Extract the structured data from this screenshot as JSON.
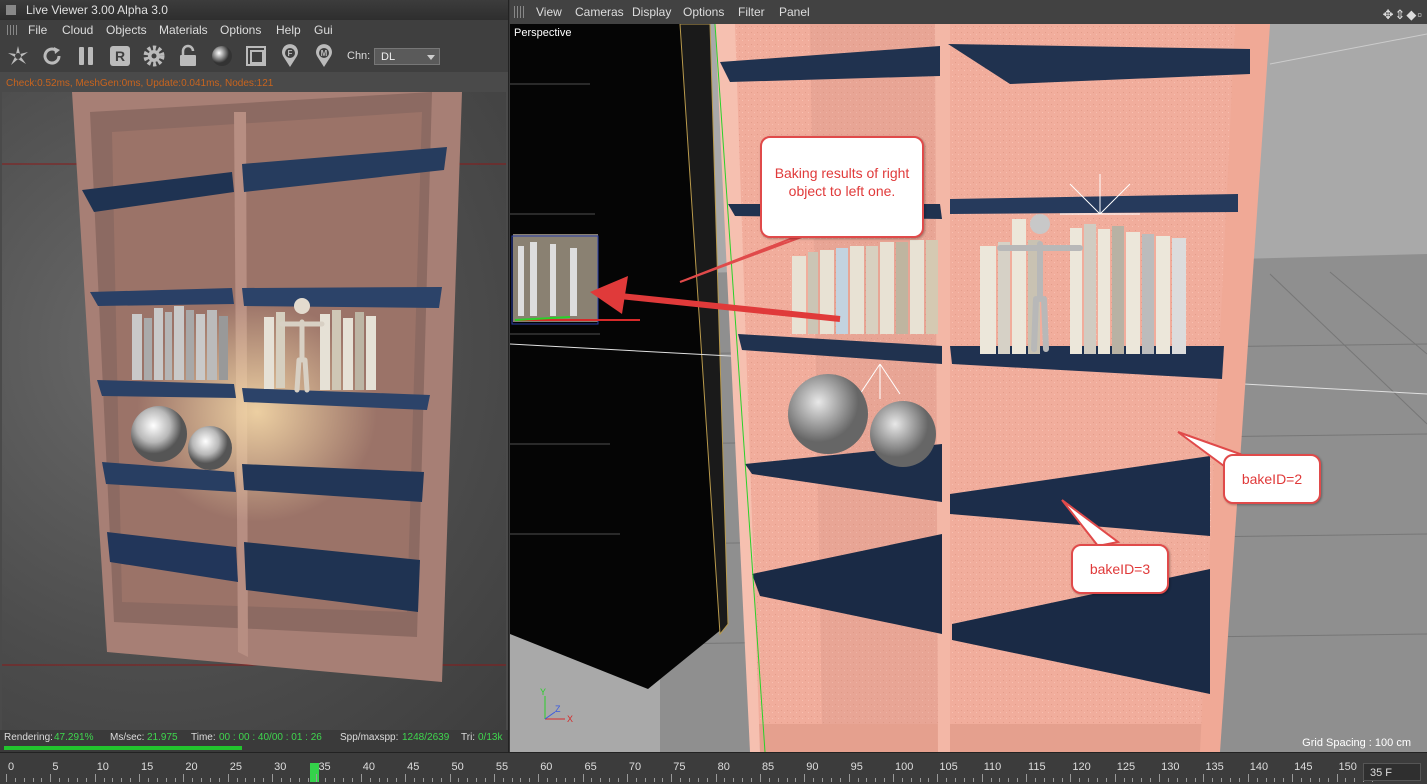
{
  "live_viewer": {
    "title": "Live Viewer 3.00 Alpha 3.0",
    "menu": [
      "File",
      "Cloud",
      "Objects",
      "Materials",
      "Options",
      "Help",
      "Gui"
    ],
    "toolbar_icons": [
      "snapshot-icon",
      "refresh-icon",
      "pause-icon",
      "region-icon",
      "settings-icon",
      "lock-icon",
      "material-ball-icon",
      "frame-icon",
      "focus-pin-icon",
      "marker-pin-icon"
    ],
    "channel_label": "Chn:",
    "channel_value": "DL",
    "stats": "Check:0.52ms, MeshGen:0ms, Update:0.041ms, Nodes:121",
    "status": {
      "rendering_label": "Rendering:",
      "rendering_value": "47.291%",
      "ms_label": "Ms/sec:",
      "ms_value": "21.975",
      "time_label": "Time:",
      "time_value": "00 : 00 : 40/00 : 01 : 26",
      "spp_label": "Spp/maxspp:",
      "spp_value": "1248/2639",
      "tri_label": "Tri:",
      "tri_value": "0/13k"
    },
    "progress": 0.47291
  },
  "viewport": {
    "menu": [
      "View",
      "Cameras",
      "Display",
      "Options",
      "Filter",
      "Panel"
    ],
    "nav_icons": [
      "move-view-icon",
      "scroll-view-icon",
      "zoom-view-icon",
      "maximize-view-icon"
    ],
    "camera_label": "Perspective",
    "grid_spacing": "Grid Spacing : 100 cm",
    "axis_labels": {
      "y": "Y",
      "x": "X",
      "z": "Z"
    },
    "callouts": {
      "baking": "Baking results of right object to left one.",
      "bake2": "bakeID=2",
      "bake3": "bakeID=3"
    }
  },
  "timeline": {
    "labels": [
      "0",
      "5",
      "10",
      "15",
      "20",
      "25",
      "30",
      "35",
      "40",
      "45",
      "50",
      "55",
      "60",
      "65",
      "70",
      "75",
      "80",
      "85",
      "90",
      "95",
      "100",
      "105",
      "110",
      "115",
      "120",
      "125",
      "130",
      "135",
      "140",
      "145",
      "150"
    ],
    "current_frame": 34,
    "frame_field": "35 F"
  },
  "colors": {
    "accent_green": "#34d24a",
    "stats_orange": "#c8641e",
    "callout_red": "#e04a4a",
    "shelf_pink": "#e9aa9a",
    "shelf_blue": "#1f3352"
  }
}
